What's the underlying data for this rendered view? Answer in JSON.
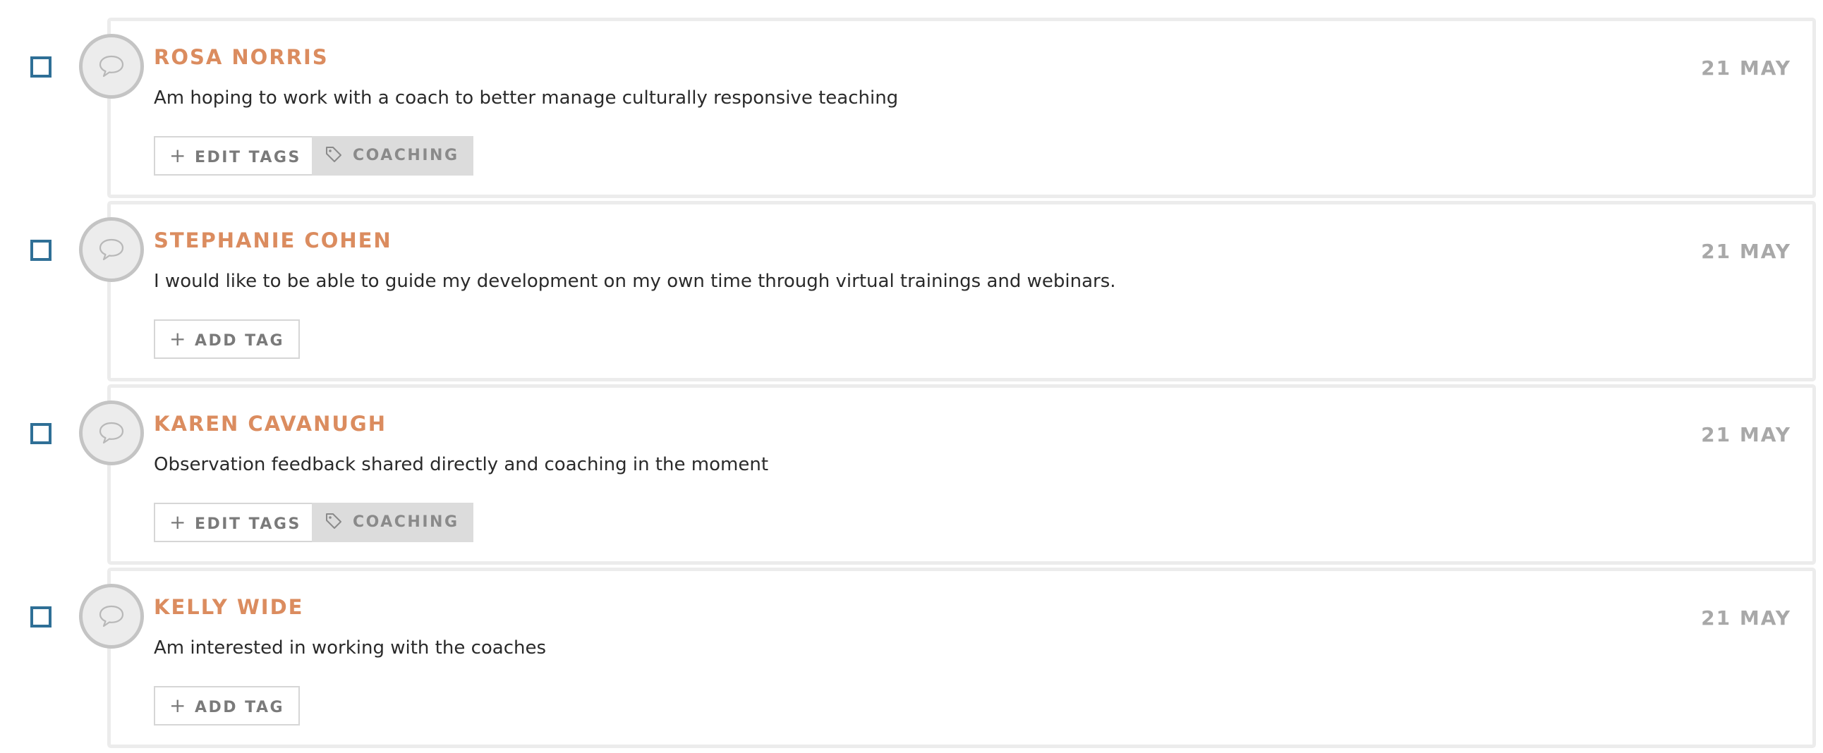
{
  "feedback_items": [
    {
      "name": "ROSA NORRIS",
      "date": "21 MAY",
      "message": "Am hoping to work with a coach to better manage culturally responsive teaching",
      "tag_button_label": "EDIT TAGS",
      "tags": [
        "COACHING"
      ]
    },
    {
      "name": "STEPHANIE COHEN",
      "date": "21 MAY",
      "message": "I would like to be able to guide my development on my own time through virtual trainings and webinars.",
      "tag_button_label": "ADD TAG",
      "tags": []
    },
    {
      "name": "KAREN CAVANUGH",
      "date": "21 MAY",
      "message": "Observation feedback shared directly and coaching in the moment",
      "tag_button_label": "EDIT TAGS",
      "tags": [
        "COACHING"
      ]
    },
    {
      "name": "KELLY WIDE",
      "date": "21 MAY",
      "message": "Am interested in working with the coaches",
      "tag_button_label": "ADD TAG",
      "tags": []
    }
  ],
  "icons": {
    "avatar": "speech-bubble-icon",
    "tag_button": "plus-icon",
    "tag_chip": "tag-icon"
  },
  "colors": {
    "name": "#db8c5f",
    "checkbox": "#2f6f96",
    "date": "#a8a8a8",
    "chip_bg": "#dcdcdc"
  }
}
